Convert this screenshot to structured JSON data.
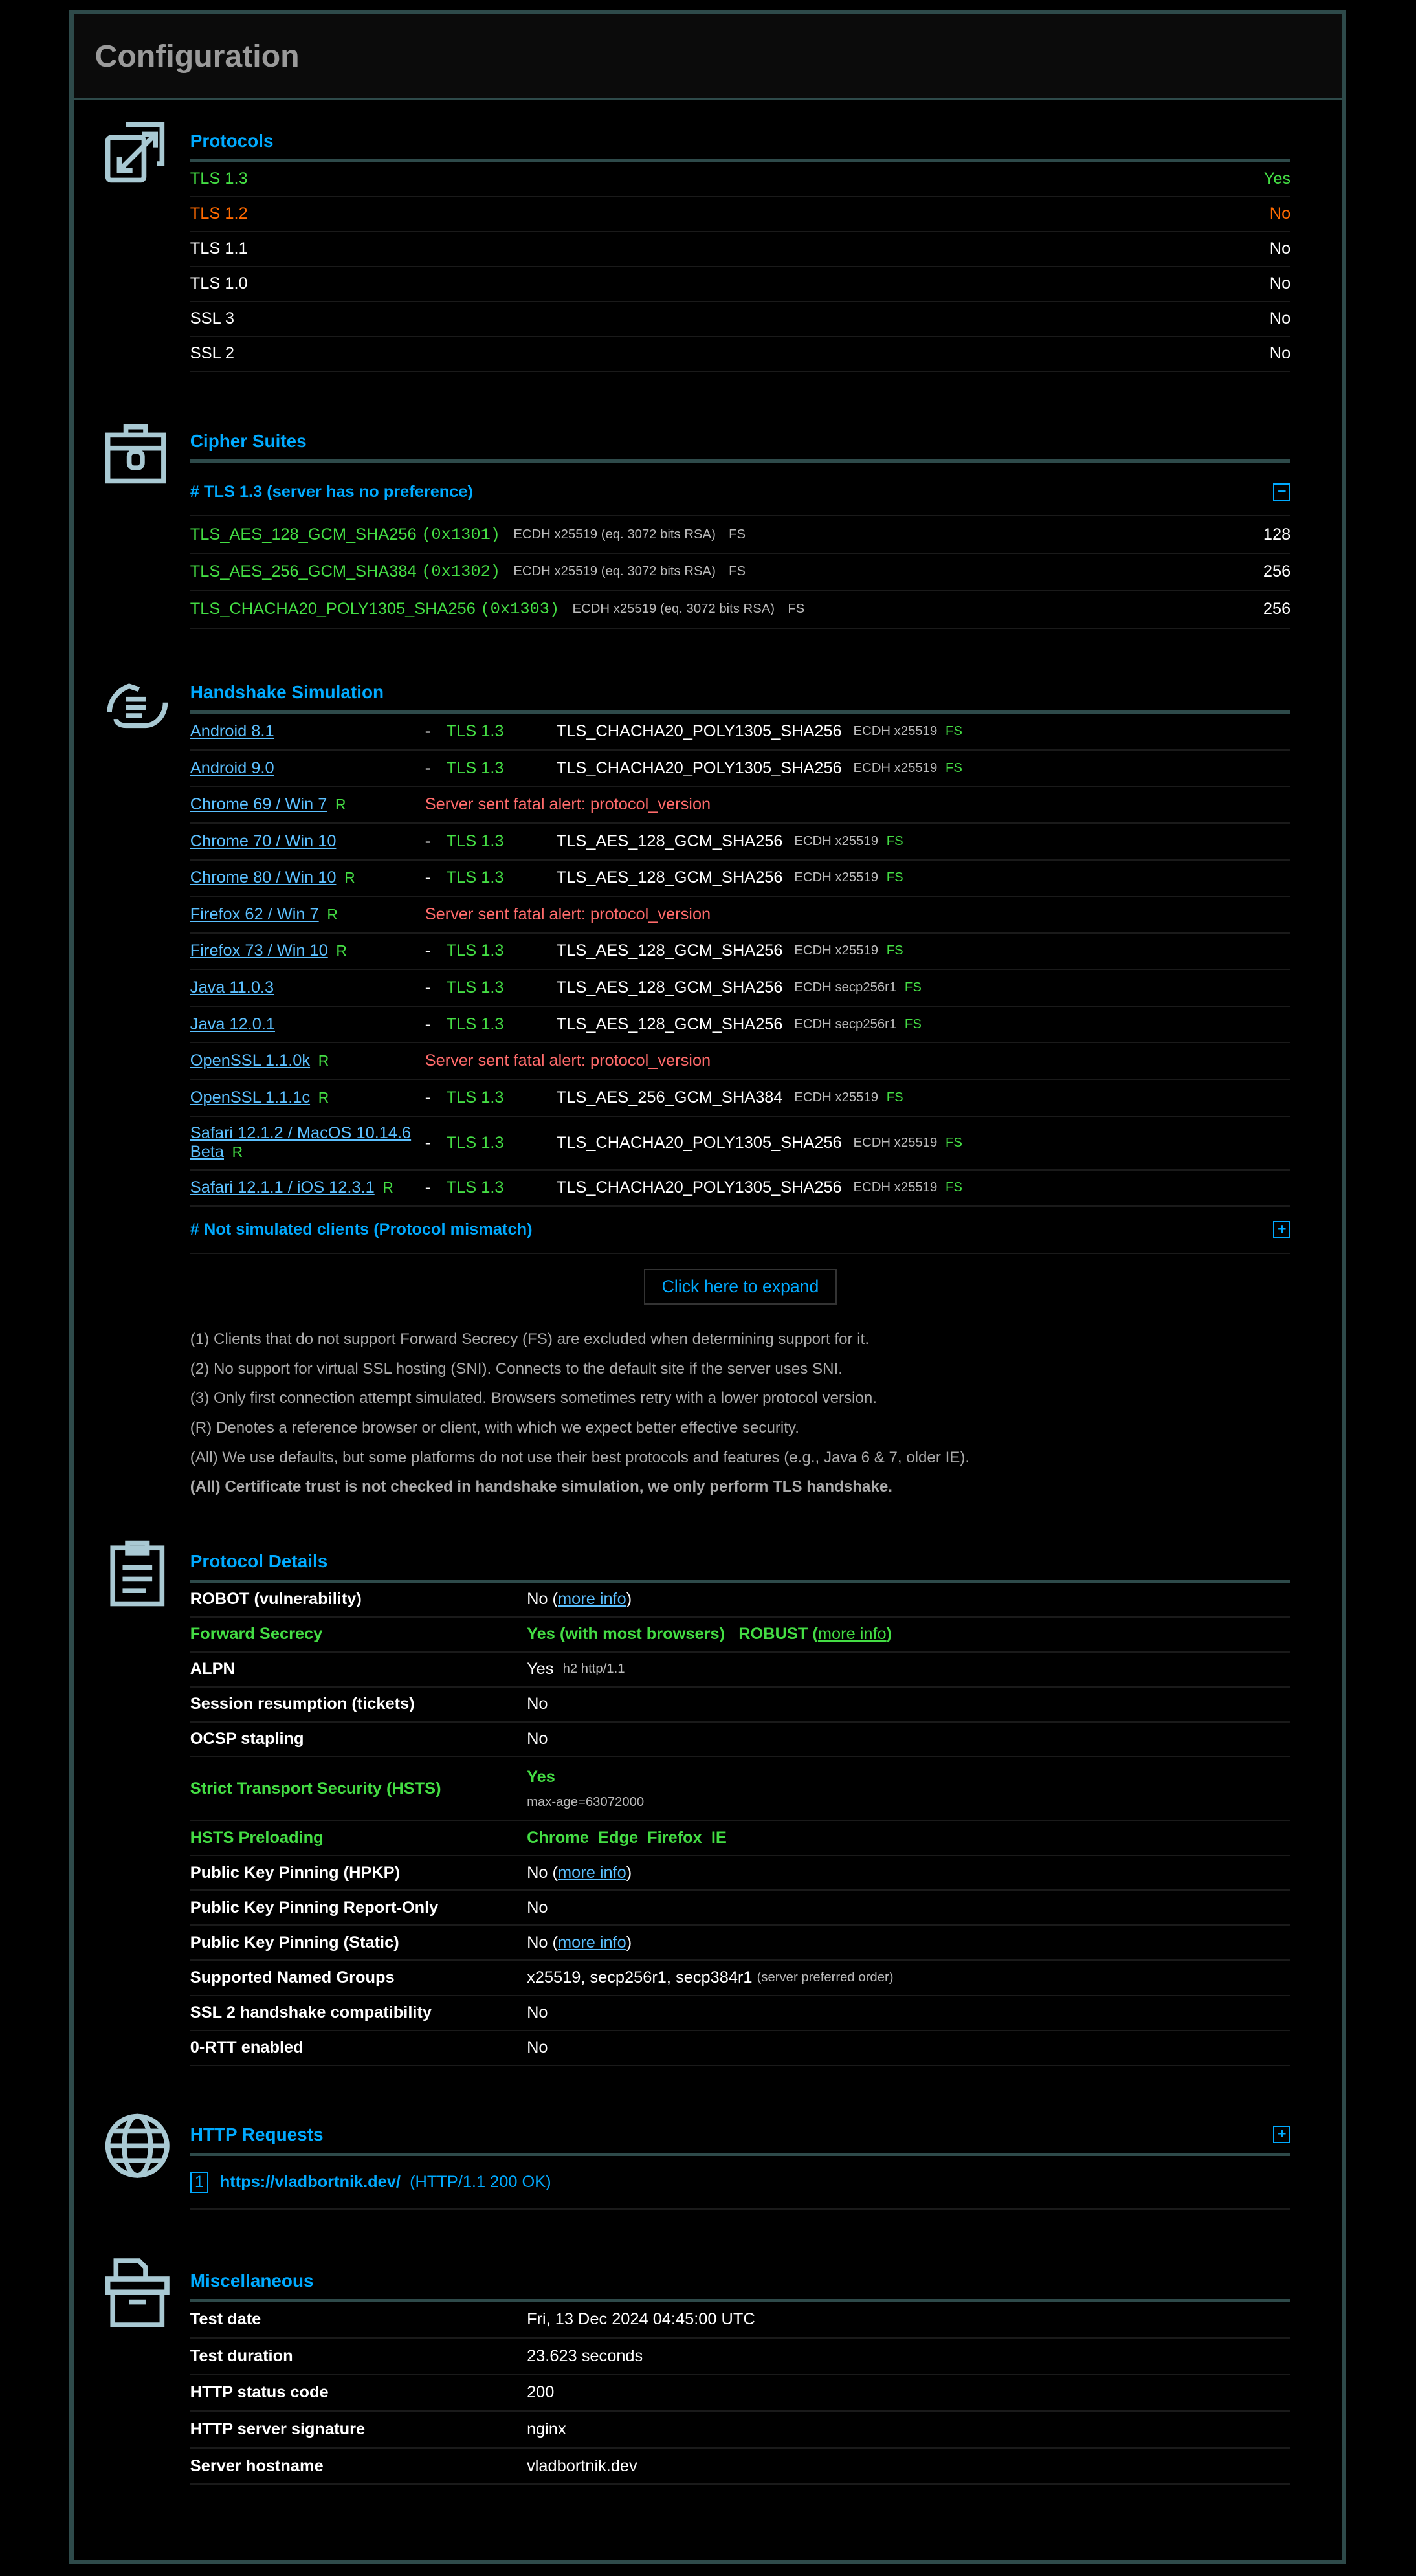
{
  "title": "Configuration",
  "protocols": {
    "title": "Protocols",
    "rows": [
      {
        "name": "TLS 1.3",
        "value": "Yes",
        "cls": "green"
      },
      {
        "name": "TLS 1.2",
        "value": "No",
        "cls": "orange"
      },
      {
        "name": "TLS 1.1",
        "value": "No",
        "cls": ""
      },
      {
        "name": "TLS 1.0",
        "value": "No",
        "cls": ""
      },
      {
        "name": "SSL 3",
        "value": "No",
        "cls": ""
      },
      {
        "name": "SSL 2",
        "value": "No",
        "cls": ""
      }
    ]
  },
  "ciphers": {
    "title": "Cipher Suites",
    "subheader": "# TLS 1.3 (server has no preference)",
    "collapse_icon": "minus-box-icon",
    "rows": [
      {
        "name": "TLS_AES_128_GCM_SHA256",
        "code": "(0x1301)",
        "kx": "ECDH x25519 (eq. 3072 bits RSA)",
        "fs": "FS",
        "bits": "128"
      },
      {
        "name": "TLS_AES_256_GCM_SHA384",
        "code": "(0x1302)",
        "kx": "ECDH x25519 (eq. 3072 bits RSA)",
        "fs": "FS",
        "bits": "256"
      },
      {
        "name": "TLS_CHACHA20_POLY1305_SHA256",
        "code": "(0x1303)",
        "kx": "ECDH x25519 (eq. 3072 bits RSA)",
        "fs": "FS",
        "bits": "256"
      }
    ]
  },
  "handshake": {
    "title": "Handshake Simulation",
    "rows": [
      {
        "client": "Android 8.1",
        "ref": "",
        "proto": "TLS 1.3",
        "cipher": "TLS_CHACHA20_POLY1305_SHA256",
        "kx": "ECDH x25519",
        "fs": "FS"
      },
      {
        "client": "Android 9.0",
        "ref": "",
        "proto": "TLS 1.3",
        "cipher": "TLS_CHACHA20_POLY1305_SHA256",
        "kx": "ECDH x25519",
        "fs": "FS"
      },
      {
        "client": "Chrome 69 / Win 7",
        "ref": "R",
        "error": "Server sent fatal alert: protocol_version"
      },
      {
        "client": "Chrome 70 / Win 10",
        "ref": "",
        "proto": "TLS 1.3",
        "cipher": "TLS_AES_128_GCM_SHA256",
        "kx": "ECDH x25519",
        "fs": "FS"
      },
      {
        "client": "Chrome 80 / Win 10",
        "ref": "R",
        "proto": "TLS 1.3",
        "cipher": "TLS_AES_128_GCM_SHA256",
        "kx": "ECDH x25519",
        "fs": "FS"
      },
      {
        "client": "Firefox 62 / Win 7",
        "ref": "R",
        "error": "Server sent fatal alert: protocol_version"
      },
      {
        "client": "Firefox 73 / Win 10",
        "ref": "R",
        "proto": "TLS 1.3",
        "cipher": "TLS_AES_128_GCM_SHA256",
        "kx": "ECDH x25519",
        "fs": "FS"
      },
      {
        "client": "Java 11.0.3",
        "ref": "",
        "proto": "TLS 1.3",
        "cipher": "TLS_AES_128_GCM_SHA256",
        "kx": "ECDH secp256r1",
        "fs": "FS"
      },
      {
        "client": "Java 12.0.1",
        "ref": "",
        "proto": "TLS 1.3",
        "cipher": "TLS_AES_128_GCM_SHA256",
        "kx": "ECDH secp256r1",
        "fs": "FS"
      },
      {
        "client": "OpenSSL 1.1.0k",
        "ref": "R",
        "error": "Server sent fatal alert: protocol_version"
      },
      {
        "client": "OpenSSL 1.1.1c",
        "ref": "R",
        "proto": "TLS 1.3",
        "cipher": "TLS_AES_256_GCM_SHA384",
        "kx": "ECDH x25519",
        "fs": "FS"
      },
      {
        "client": "Safari 12.1.2 / MacOS 10.14.6 Beta",
        "ref": "R",
        "proto": "TLS 1.3",
        "cipher": "TLS_CHACHA20_POLY1305_SHA256",
        "kx": "ECDH x25519",
        "fs": "FS"
      },
      {
        "client": "Safari 12.1.1 / iOS 12.3.1",
        "ref": "R",
        "proto": "TLS 1.3",
        "cipher": "TLS_CHACHA20_POLY1305_SHA256",
        "kx": "ECDH x25519",
        "fs": "FS"
      }
    ],
    "bullet": "-",
    "not_simulated": "# Not simulated clients (Protocol mismatch)",
    "expand_label": "Click here to expand",
    "notes": [
      "(1) Clients that do not support Forward Secrecy (FS) are excluded when determining support for it.",
      "(2) No support for virtual SSL hosting (SNI). Connects to the default site if the server uses SNI.",
      "(3) Only first connection attempt simulated. Browsers sometimes retry with a lower protocol version.",
      "(R) Denotes a reference browser or client, with which we expect better effective security.",
      "(All) We use defaults, but some platforms do not use their best protocols and features (e.g., Java 6 & 7, older IE).",
      "(All) Certificate trust is not checked in handshake simulation, we only perform TLS handshake."
    ]
  },
  "details": {
    "title": "Protocol Details",
    "more_info": "more info",
    "robot": {
      "k": "ROBOT (vulnerability)",
      "v": "No ("
    },
    "fs": {
      "k": "Forward Secrecy",
      "v": "Yes (with most browsers)",
      "robust": "ROBUST"
    },
    "alpn": {
      "k": "ALPN",
      "v": "Yes",
      "extra": "h2 http/1.1"
    },
    "session": {
      "k": "Session resumption (tickets)",
      "v": "No"
    },
    "ocsp": {
      "k": "OCSP stapling",
      "v": "No"
    },
    "hsts": {
      "k": "Strict Transport Security (HSTS)",
      "v": "Yes",
      "extra": "max-age=63072000"
    },
    "preload": {
      "k": "HSTS Preloading",
      "v": "Chrome  Edge  Firefox  IE"
    },
    "hpkp": {
      "k": "Public Key Pinning (HPKP)",
      "v": "No ("
    },
    "hpkp_ro": {
      "k": "Public Key Pinning Report-Only",
      "v": "No"
    },
    "hpkp_static": {
      "k": "Public Key Pinning (Static)",
      "v": "No ("
    },
    "groups": {
      "k": "Supported Named Groups",
      "v": "x25519, secp256r1, secp384r1",
      "extra": "(server preferred order)"
    },
    "ssl2": {
      "k": "SSL 2 handshake compatibility",
      "v": "No"
    },
    "rtt": {
      "k": "0-RTT enabled",
      "v": "No"
    }
  },
  "http": {
    "title": "HTTP Requests",
    "index": "1",
    "url": "https://vladbortnik.dev/",
    "status": "(HTTP/1.1 200 OK)"
  },
  "misc": {
    "title": "Miscellaneous",
    "rows": [
      {
        "k": "Test date",
        "v": "Fri, 13 Dec 2024 04:45:00 UTC"
      },
      {
        "k": "Test duration",
        "v": "23.623 seconds"
      },
      {
        "k": "HTTP status code",
        "v": "200"
      },
      {
        "k": "HTTP server signature",
        "v": "nginx"
      },
      {
        "k": "Server hostname",
        "v": "vladbortnik.dev"
      }
    ]
  }
}
